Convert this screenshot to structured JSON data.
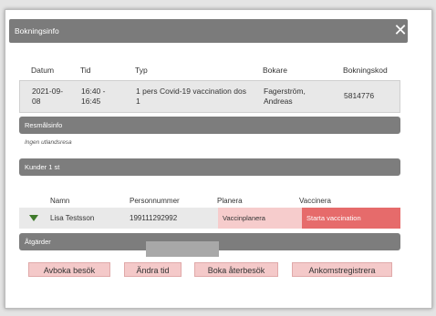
{
  "dialog": {
    "title": "Bokningsinfo"
  },
  "booking": {
    "headers": [
      "Datum",
      "Tid",
      "Typ",
      "Bokare",
      "Bokningskod"
    ],
    "row": {
      "date_line1": "2021-09-",
      "date_line2": "08",
      "time_line1": "16:40 -",
      "time_line2": "16:45",
      "type_line1": "1 pers Covid-19 vaccination dos",
      "type_line2": "1",
      "booker_line1": "Fagerström,",
      "booker_line2": "Andreas",
      "code": "5814776"
    }
  },
  "travel": {
    "header": "Resmålsinfo",
    "note": "Ingen utlandsresa"
  },
  "customers": {
    "header": "Kunder 1 st",
    "columns": [
      "Namn",
      "Personnummer",
      "Planera",
      "Vaccinera"
    ],
    "rows": [
      {
        "name": "Lisa Testsson",
        "personnummer": "199111292992",
        "planera": "Vaccinplanera",
        "vaccinera": "Starta vaccination"
      }
    ]
  },
  "actions": {
    "header": "Åtgärder",
    "buttons": [
      "Avboka besök",
      "Ändra tid",
      "Boka återbesök",
      "Ankomstregistrera"
    ]
  },
  "colors": {
    "section_bar": "#7d7d7d",
    "plan_cell": "#f6cccc",
    "vaccinate_button": "#e66b6b",
    "action_button": "#f4c9c9"
  },
  "icons": {
    "close": "close-icon",
    "expand": "expand-triangle-icon"
  }
}
